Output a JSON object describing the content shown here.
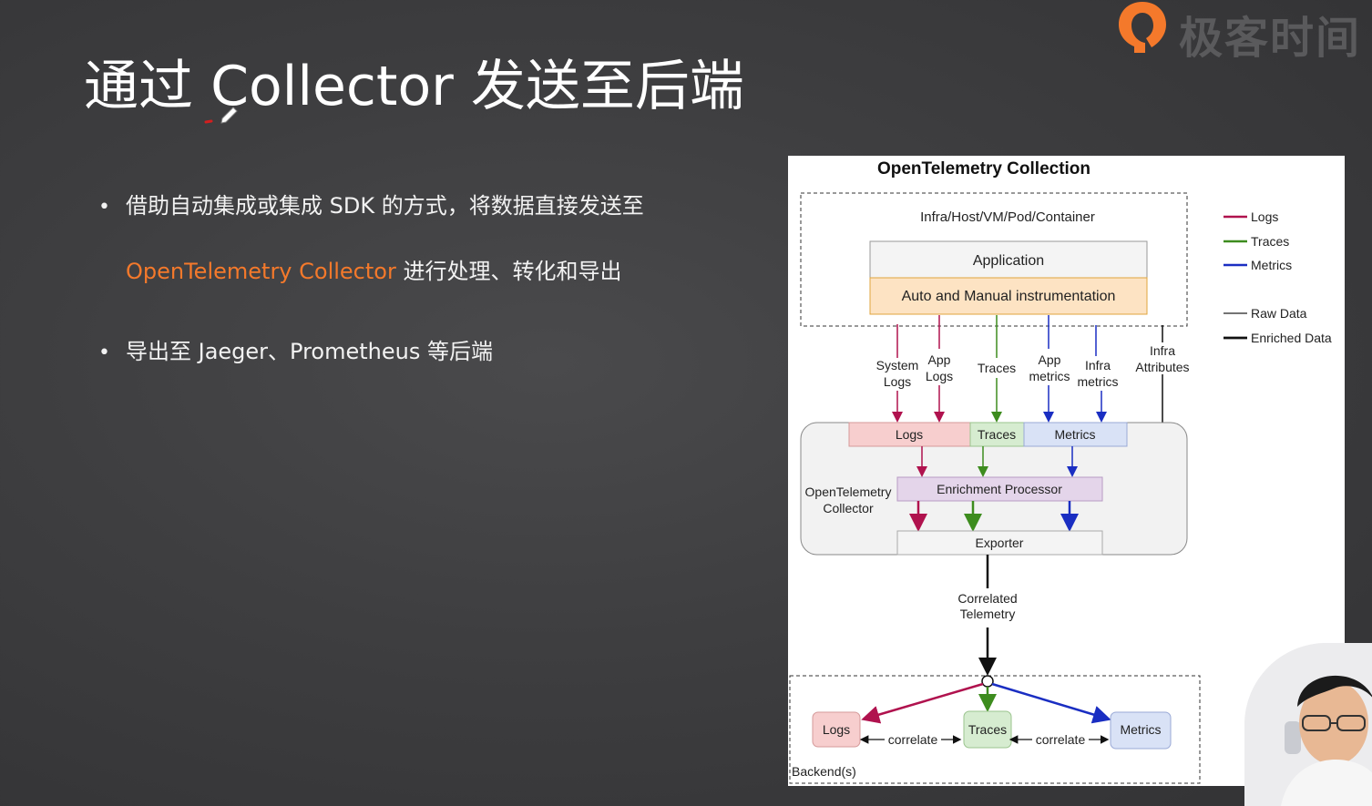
{
  "brand": {
    "name": "极客时间",
    "icon": "geekbang-logo",
    "accent": "#f4792b"
  },
  "slide": {
    "title": "通过 Collector 发送至后端",
    "bullets": [
      {
        "text": "借助自动集成或集成 SDK 的方式，将数据直接发送至",
        "highlight": "OpenTelemetry Collector",
        "rest": " 进行处理、转化和导出"
      },
      {
        "text": "导出至 Jaeger、Prometheus 等后端"
      }
    ],
    "bullet_symbol": "•"
  },
  "diagram": {
    "title": "OpenTelemetry Collection",
    "infra_label": "Infra/Host/VM/Pod/Container",
    "application": "Application",
    "instrumentation": "Auto and Manual instrumentation",
    "flows": {
      "system_logs": [
        "System",
        "Logs"
      ],
      "app_logs": [
        "App",
        "Logs"
      ],
      "traces": "Traces",
      "app_metrics": [
        "App",
        "metrics"
      ],
      "infra_metrics": [
        "Infra",
        "metrics"
      ],
      "infra_attributes": [
        "Infra",
        "Attributes"
      ]
    },
    "collector": {
      "label": [
        "OpenTelemetry",
        "Collector"
      ],
      "logs": "Logs",
      "traces": "Traces",
      "metrics": "Metrics",
      "processor": "Enrichment Processor",
      "exporter": "Exporter"
    },
    "correlated": [
      "Correlated",
      "Telemetry"
    ],
    "backend": {
      "label": "Backend(s)",
      "logs": "Logs",
      "traces": "Traces",
      "metrics": "Metrics",
      "correlate": "correlate"
    },
    "legend": [
      {
        "label": "Logs",
        "color": "#b0124e"
      },
      {
        "label": "Traces",
        "color": "#3d8c1e"
      },
      {
        "label": "Metrics",
        "color": "#1a2ec2"
      },
      {
        "label": "Raw Data",
        "color": "#222222",
        "style": "thin"
      },
      {
        "label": "Enriched Data",
        "color": "#111111",
        "style": "thick"
      }
    ],
    "colors": {
      "logs_fill": "#f7cece",
      "traces_fill": "#d6ecd0",
      "metrics_fill": "#d9e2f6",
      "processor_fill": "#e4d5ea",
      "instrumentation_fill": "#fde3c3",
      "application_fill": "#f4f4f4"
    }
  }
}
